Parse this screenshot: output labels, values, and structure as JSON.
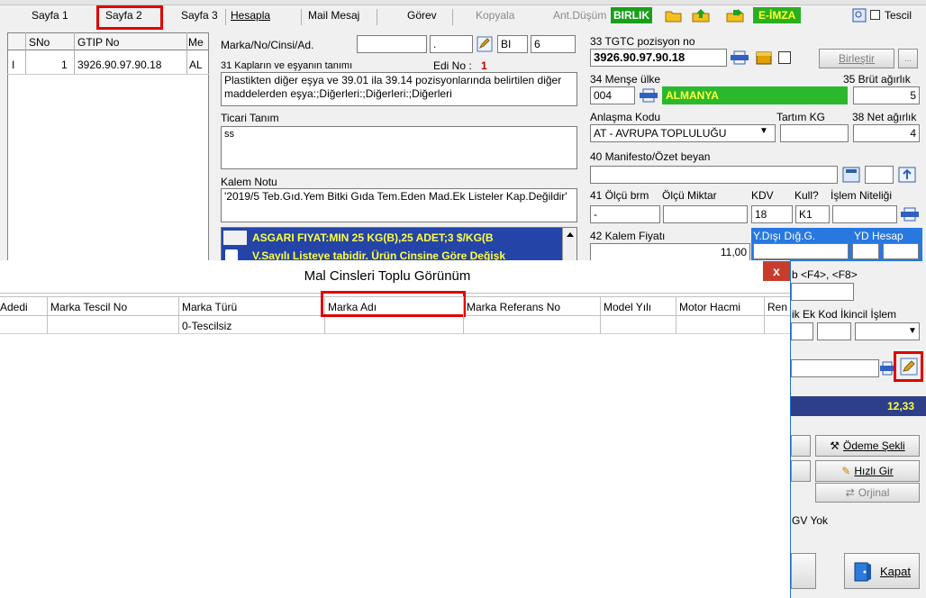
{
  "toolbar": {
    "tabs": [
      "Sayfa 1",
      "Sayfa 2",
      "Sayfa 3",
      "Hesapla",
      "Mail Mesaj",
      "Görev",
      "Kopyala",
      "Ant.Düşüm"
    ],
    "birlik": "BIRLIK",
    "eimza": "E-İMZA",
    "tescil": "Tescil"
  },
  "left_grid": {
    "headers": [
      "SNo",
      "GTIP No",
      "Me"
    ],
    "row": {
      "marker": "I",
      "sno": "1",
      "gtip": "3926.90.97.90.18",
      "me": "AL"
    }
  },
  "form": {
    "marka_label": "Marka/No/Cinsi/Ad.",
    "marka_val1": "",
    "marka_val2": ".",
    "bi_val": "BI",
    "bi_num": "6",
    "kap_label": "31 Kapların ve eşyanın tanımı",
    "edi_label": "Edi No :",
    "edi_val": "1",
    "kap_desc": "Plastikten diğer eşya ve 39.01 ila 39.14 pozisyonlarında belirtilen diğer maddelerden eşya:;Diğerleri:;Diğerleri:;Diğerleri",
    "ticari_label": "Ticari Tanım",
    "ticari_val": "ss",
    "kalem_label": "Kalem Notu",
    "kalem_val": "'2019/5 Teb.Gıd.Yem Bitki Gıda Tem.Eden Mad.Ek Listeler Kap.Değildir'",
    "asgari": "ASGARI FIYAT:MIN 25 KG(B),25 ADET;3 $/KG(B",
    "gozetim": "V.Sayılı Listeye tabidir. Ürün Cinsine Göre Değişk"
  },
  "right": {
    "tgtc_label": "33 TGTC pozisyon no",
    "tgtc_val": "3926.90.97.90.18",
    "birlestir": "Birleştir",
    "more": "...",
    "mense_label": "34 Menşe ülke",
    "mense_code": "004",
    "mense_name": "ALMANYA",
    "brut_label": "35 Brüt ağırlık",
    "brut_val": "5",
    "anlasma_label": "Anlaşma Kodu",
    "anlasma_val": "AT   - AVRUPA TOPLULUĞU",
    "tartim_label": "Tartım KG",
    "net_label": "38 Net ağırlık",
    "net_val": "4",
    "manifesto_label": "40 Manifesto/Özet beyan",
    "olcu_label": "41 Ölçü brm",
    "olcu_miktar_label": "Ölçü Miktar",
    "kdv_label": "KDV",
    "kull_label": "Kull?",
    "islem_label": "İşlem Niteliği",
    "olcu_val": "-",
    "kdv_val": "18",
    "kull_val": "K1",
    "fiyat_label": "42 Kalem Fiyatı",
    "fiyat_val": "11,00",
    "ydisi_label": "Y.Dışı Dığ.G.",
    "ydhesap_label": "YD Hesap",
    "f4f8": "b <F4>, <F8>",
    "ekkod_label": "ik Ek Kod İkincil İşlem",
    "total": "12,33",
    "odeme": "Ödeme Şekli",
    "hizli": "Hızlı Gir",
    "orjinal": "Orjinal",
    "gv_yok": "GV Yok",
    "kapat": "Kapat"
  },
  "dialog": {
    "title": "Mal Cinsleri Toplu Görünüm",
    "close": "x",
    "headers": [
      "Adedi",
      "Marka Tescil No",
      "Marka Türü",
      "Marka Adı",
      "Marka Referans No",
      "Model Yılı",
      "Motor Hacmi",
      "Ren"
    ],
    "rows": [
      [
        "",
        "",
        "0-Tescilsiz",
        "",
        "",
        "",
        "",
        ""
      ]
    ]
  }
}
